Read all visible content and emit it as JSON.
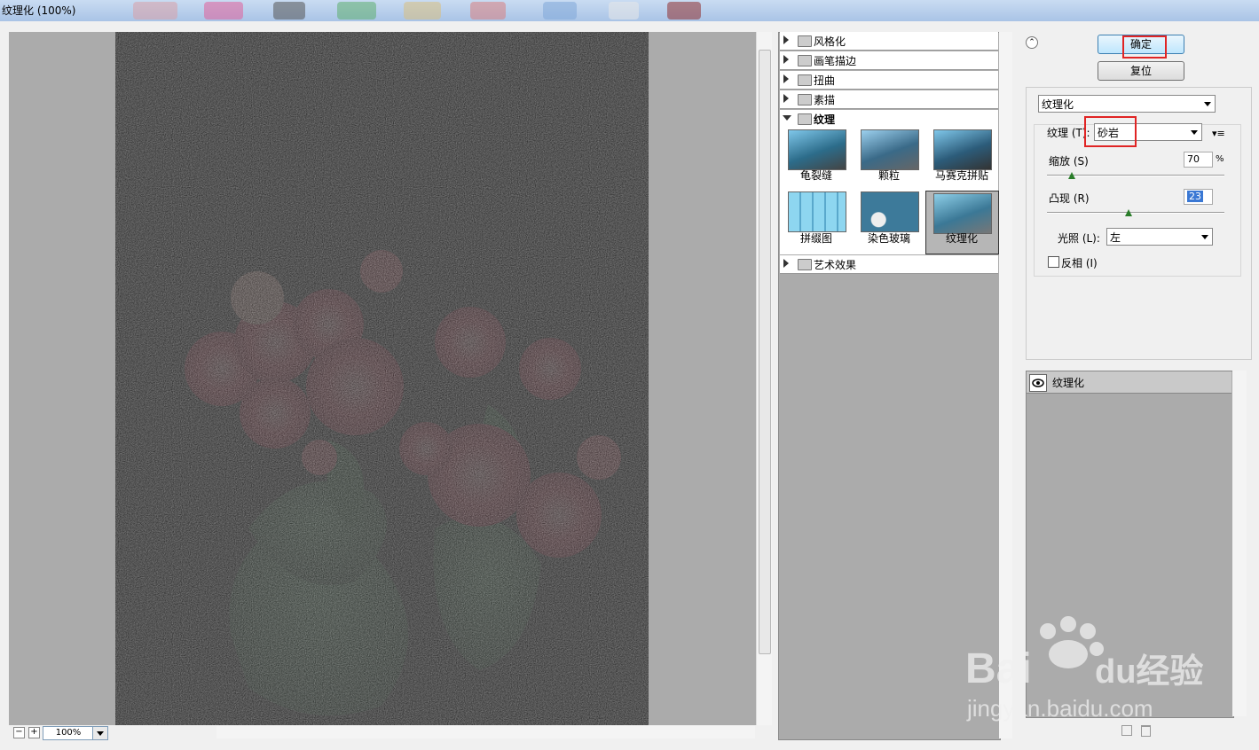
{
  "window": {
    "title": "纹理化 (100%)"
  },
  "zoom": {
    "value": "100%",
    "minus": "−",
    "plus": "+"
  },
  "gallery": {
    "categories_top": [
      "风格化",
      "画笔描边",
      "扭曲",
      "素描"
    ],
    "open_category": "纹理",
    "thumbs": [
      "龟裂缝",
      "颗粒",
      "马赛克拼贴",
      "拼缀图",
      "染色玻璃",
      "纹理化"
    ],
    "selected": "纹理化",
    "category_bottom": "艺术效果"
  },
  "buttons": {
    "ok": "确定",
    "reset": "复位"
  },
  "settings": {
    "filter_select": "纹理化",
    "texture_label": "纹理 (T):",
    "texture_value": "砂岩",
    "scale_label": "缩放 (S)",
    "scale_value": "70",
    "scale_unit": "%",
    "scale_level": 0.14,
    "relief_label": "凸现 (R)",
    "relief_value": "23",
    "relief_level": 0.46,
    "light_label": "光照 (L):",
    "light_value": "左",
    "invert_label": "反相 (I)",
    "invert_checked": false
  },
  "layers": {
    "items": [
      "纹理化"
    ]
  },
  "watermark": {
    "logo": "Baidu经验",
    "url": "jingyan.baidu.com"
  },
  "colors": {
    "ok_border_highlight": "#e02424",
    "knob": "#2a7d2a"
  }
}
